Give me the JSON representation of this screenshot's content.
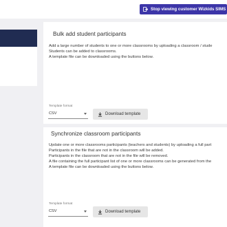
{
  "header": {
    "impersonate_button": "Stop viewing customer Wizkids SIMS",
    "impersonate_icon": "exit-icon"
  },
  "bulk_add": {
    "title": "Bulk add student participants",
    "description_lines": [
      "Add a large number of students to one or more classrooms by uploading a classroom / stude",
      "Students can be added to classrooms.",
      "A template file can be downloaded using the buttons below."
    ],
    "template_format_label": "Template format",
    "template_format_value": "CSV",
    "download_button": "Download template"
  },
  "sync": {
    "title": "Synchronize classroom participants",
    "description_lines": [
      "Update one or more classrooms participants (teachers and students) by uploading a full part",
      "Participants in the file that are not in the classroom will be added.",
      "Participants in the classroom that are not in the file will be removed.",
      "A file containing the full participant list of one or more classrooms can be generated from the",
      "A template file can be downloaded using the buttons below."
    ],
    "template_format_label": "Template format",
    "template_format_value": "CSV",
    "download_button": "Download template"
  },
  "colors": {
    "accent": "#3c35a8",
    "sidebar_active": "#202c52",
    "background": "#f0f0f3"
  }
}
